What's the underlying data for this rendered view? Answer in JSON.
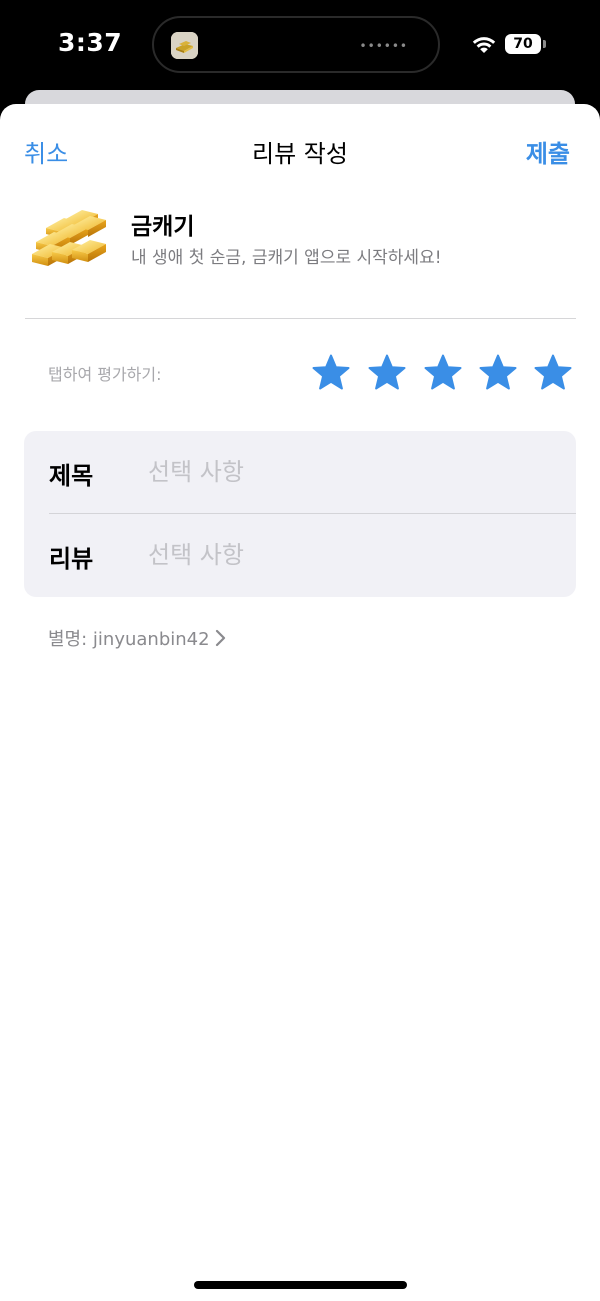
{
  "status_bar": {
    "time": "3:37",
    "battery": "70",
    "island_dots": "••••••"
  },
  "nav": {
    "cancel_label": "취소",
    "title": "리뷰 작성",
    "submit_label": "제출"
  },
  "app": {
    "name": "금캐기",
    "description": "내 생애 첫 순금, 금캐기 앱으로 시작하세요!",
    "icon": "gold-bars-icon"
  },
  "rating": {
    "prompt": "탭하여 평가하기:",
    "stars": 5,
    "star_color": "#3a8ee6"
  },
  "form": {
    "title_label": "제목",
    "title_placeholder": "선택 사항",
    "review_label": "리뷰",
    "review_placeholder": "선택 사항"
  },
  "nickname": {
    "text": "별명: jinyuanbin42"
  },
  "colors": {
    "accent": "#3a8ee6",
    "secondary_text": "#7c7c80",
    "card_bg": "#f1f1f6"
  }
}
